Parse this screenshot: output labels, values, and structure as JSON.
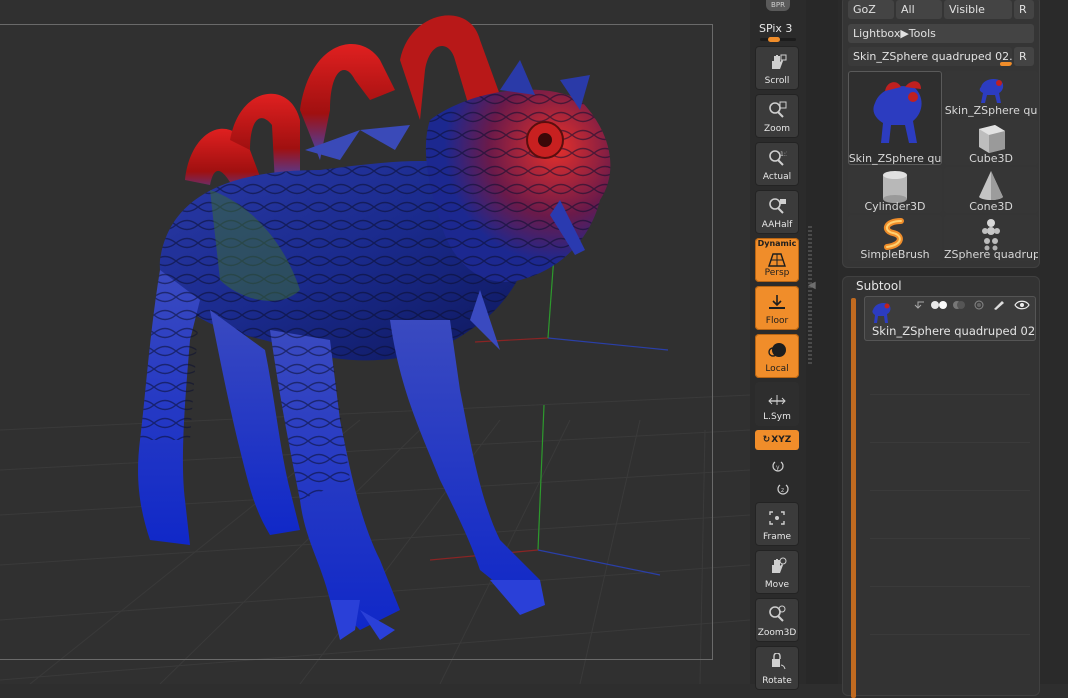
{
  "shelf": {
    "bpr_label": "BPR",
    "spix_label": "SPix 3",
    "spix_value": 3,
    "buttons": [
      {
        "label": "Scroll",
        "active": false,
        "icon": "hand-scroll-icon"
      },
      {
        "label": "Zoom",
        "active": false,
        "icon": "magnifier-zoom-icon"
      },
      {
        "label": "Actual",
        "active": false,
        "icon": "magnifier-actual-icon"
      },
      {
        "label": "AAHalf",
        "active": false,
        "icon": "magnifier-aahalf-icon"
      },
      {
        "label": "Persp",
        "active": true,
        "tag": "Dynamic",
        "icon": "perspective-grid-icon"
      },
      {
        "label": "Floor",
        "active": true,
        "icon": "floor-icon"
      },
      {
        "label": "Local",
        "active": true,
        "icon": "local-sphere-icon"
      },
      {
        "label": "L.Sym",
        "active": false,
        "icon": "local-symmetry-icon"
      },
      {
        "label": "Frame",
        "active": false,
        "icon": "frame-icon"
      },
      {
        "label": "Move",
        "active": false,
        "icon": "hand-move-icon"
      },
      {
        "label": "Zoom3D",
        "active": false,
        "icon": "zoom3d-icon"
      },
      {
        "label": "Rotate",
        "active": false,
        "icon": "rotate-icon"
      }
    ],
    "xyz_label": "XYZ",
    "xyz_active": true
  },
  "tool_panel": {
    "goz_label": "GoZ",
    "all_label": "All",
    "visible_label": "Visible",
    "r_label": "R",
    "lightbox_label": "Lightbox▶Tools",
    "current_tool": "Skin_ZSphere quadruped 02.",
    "r2_label": "R",
    "thumbnails": [
      {
        "label": "Skin_ZSphere qu",
        "selected": true
      },
      {
        "label": "Skin_ZSphere qu",
        "selected": false
      },
      {
        "label": "Cube3D",
        "selected": false
      },
      {
        "label": "Cylinder3D",
        "selected": false
      },
      {
        "label": "Cone3D",
        "selected": false
      },
      {
        "label": "SimpleBrush",
        "selected": false
      },
      {
        "label": "ZSphere quadrup",
        "selected": false
      }
    ]
  },
  "subtool": {
    "title": "Subtool",
    "items": [
      {
        "label": "Skin_ZSphere quadruped 02"
      }
    ]
  },
  "colors": {
    "accent": "#f08d2a",
    "background": "#303030",
    "panel": "#353535"
  }
}
